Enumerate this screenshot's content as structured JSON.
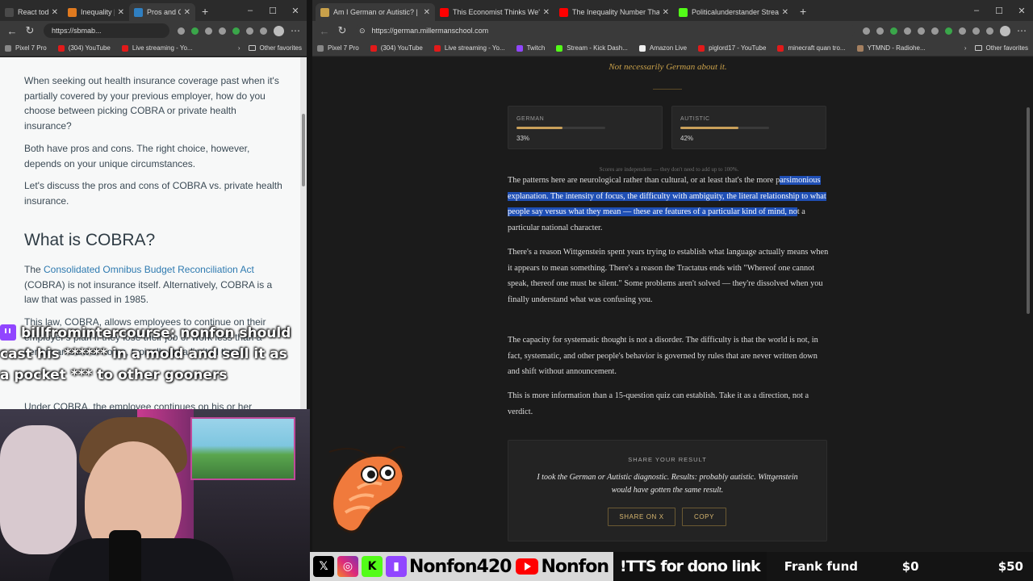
{
  "left_browser": {
    "tabs": [
      {
        "label": "React today | ",
        "icon_color": "#4a4a4a",
        "active": false
      },
      {
        "label": "Inequality | N",
        "icon_color": "#e07a1f",
        "active": false
      },
      {
        "label": "Pros and Cons",
        "icon_color": "#2f7fc1",
        "active": true
      }
    ],
    "url": "https://sbmab...",
    "bookmarks": [
      "Pixel 7 Pro",
      "(304) YouTube",
      "Live streaming - Yo..."
    ],
    "other_favorites": "Other favorites"
  },
  "left_page": {
    "para1": "When seeking out health insurance coverage past when it's partially covered by your previous employer, how do you choose between picking COBRA or private health insurance?",
    "para2": "Both have pros and cons. The right choice, however, depends on your unique circumstances.",
    "para3": "Let's discuss the pros and cons of COBRA vs. private health insurance.",
    "heading": "What is COBRA?",
    "para4_prefix": "The ",
    "para4_link": "Consolidated Omnibus Budget Reconciliation Act",
    "para4_rest": " (COBRA) is not insurance itself. Alternatively, COBRA is a law that was passed in 1985.",
    "para5": "This law, COBRA, allows employees to continue on their employer's plan if they lose their job or work less than a certain amount of hours, typically for a limited time.",
    "para6": "Under COBRA, the employee continues on his or her"
  },
  "right_browser": {
    "tabs": [
      {
        "label": "Am I German or Autistic? | Millerm",
        "icon_color": "#c8a04a",
        "active": true
      },
      {
        "label": "This Economist Thinks We're Wron",
        "icon_color": "#ff0000",
        "active": false
      },
      {
        "label": "The Inequality Number That Chang",
        "icon_color": "#ff0000",
        "active": false
      },
      {
        "label": "Politicalunderstander Stream - Wa",
        "icon_color": "#53fc18",
        "active": false
      }
    ],
    "url": "https://german.millermanschool.com",
    "bookmarks": [
      "Pixel 7 Pro",
      "(304) YouTube",
      "Live streaming - Yo...",
      "Twitch",
      "Stream - Kick Dash...",
      "Amazon Live",
      "piglord17 - YouTube",
      "minecraft quan tro...",
      "YTMND - Radiohe..."
    ],
    "other_favorites": "Other favorites"
  },
  "result_page": {
    "tagline": "Not necessarily German about it.",
    "cards": [
      {
        "label": "GERMAN",
        "value": "33%",
        "fraction": 0.33
      },
      {
        "label": "AUTISTIC",
        "value": "42%",
        "fraction": 0.42
      }
    ],
    "note": "Scores are independent — they don't need to add up to 100%.",
    "p1_pre": "The patterns here are neurological rather than cultural, or at least that's the more p",
    "p1_hl": "arsimonious explanation. The intensity of focus, the difficulty with ambiguity, the literal relationship to what people say versus what they mean — these are features of a particular kind of mind, no",
    "p1_post": "t a particular national character.",
    "p2": "There's a reason Wittgenstein spent years trying to establish what language actually means when it appears to mean something. There's a reason the Tractatus ends with \"Whereof one cannot speak, thereof one must be silent.\" Some problems aren't solved — they're dissolved when you finally understand what was confusing you.",
    "p3": "The capacity for systematic thought is not a disorder. The difficulty is that the world is not, in fact, systematic, and other people's behavior is governed by rules that are never written down and shift without announcement.",
    "p4": "This is more information than a 15-question quiz can establish. Take it as a direction, not a verdict.",
    "share_title": "SHARE YOUR RESULT",
    "share_quote": "I took the German or Autistic diagnostic. Results: probably autistic. Wittgenstein would have gotten the same result.",
    "share_x": "SHARE ON X",
    "copy": "COPY"
  },
  "stream_overlay": {
    "chat_user": "billfromintercourse:",
    "chat_msg": "nonfon should cast his ****** in a mold and sell it as a pocket *** to other gooners",
    "handle1": "Nonfon420",
    "handle2": "Nonfon",
    "tts": "!TTS for dono link",
    "fund_label": "Frank fund",
    "fund_current": "$0",
    "fund_goal": "$50"
  }
}
